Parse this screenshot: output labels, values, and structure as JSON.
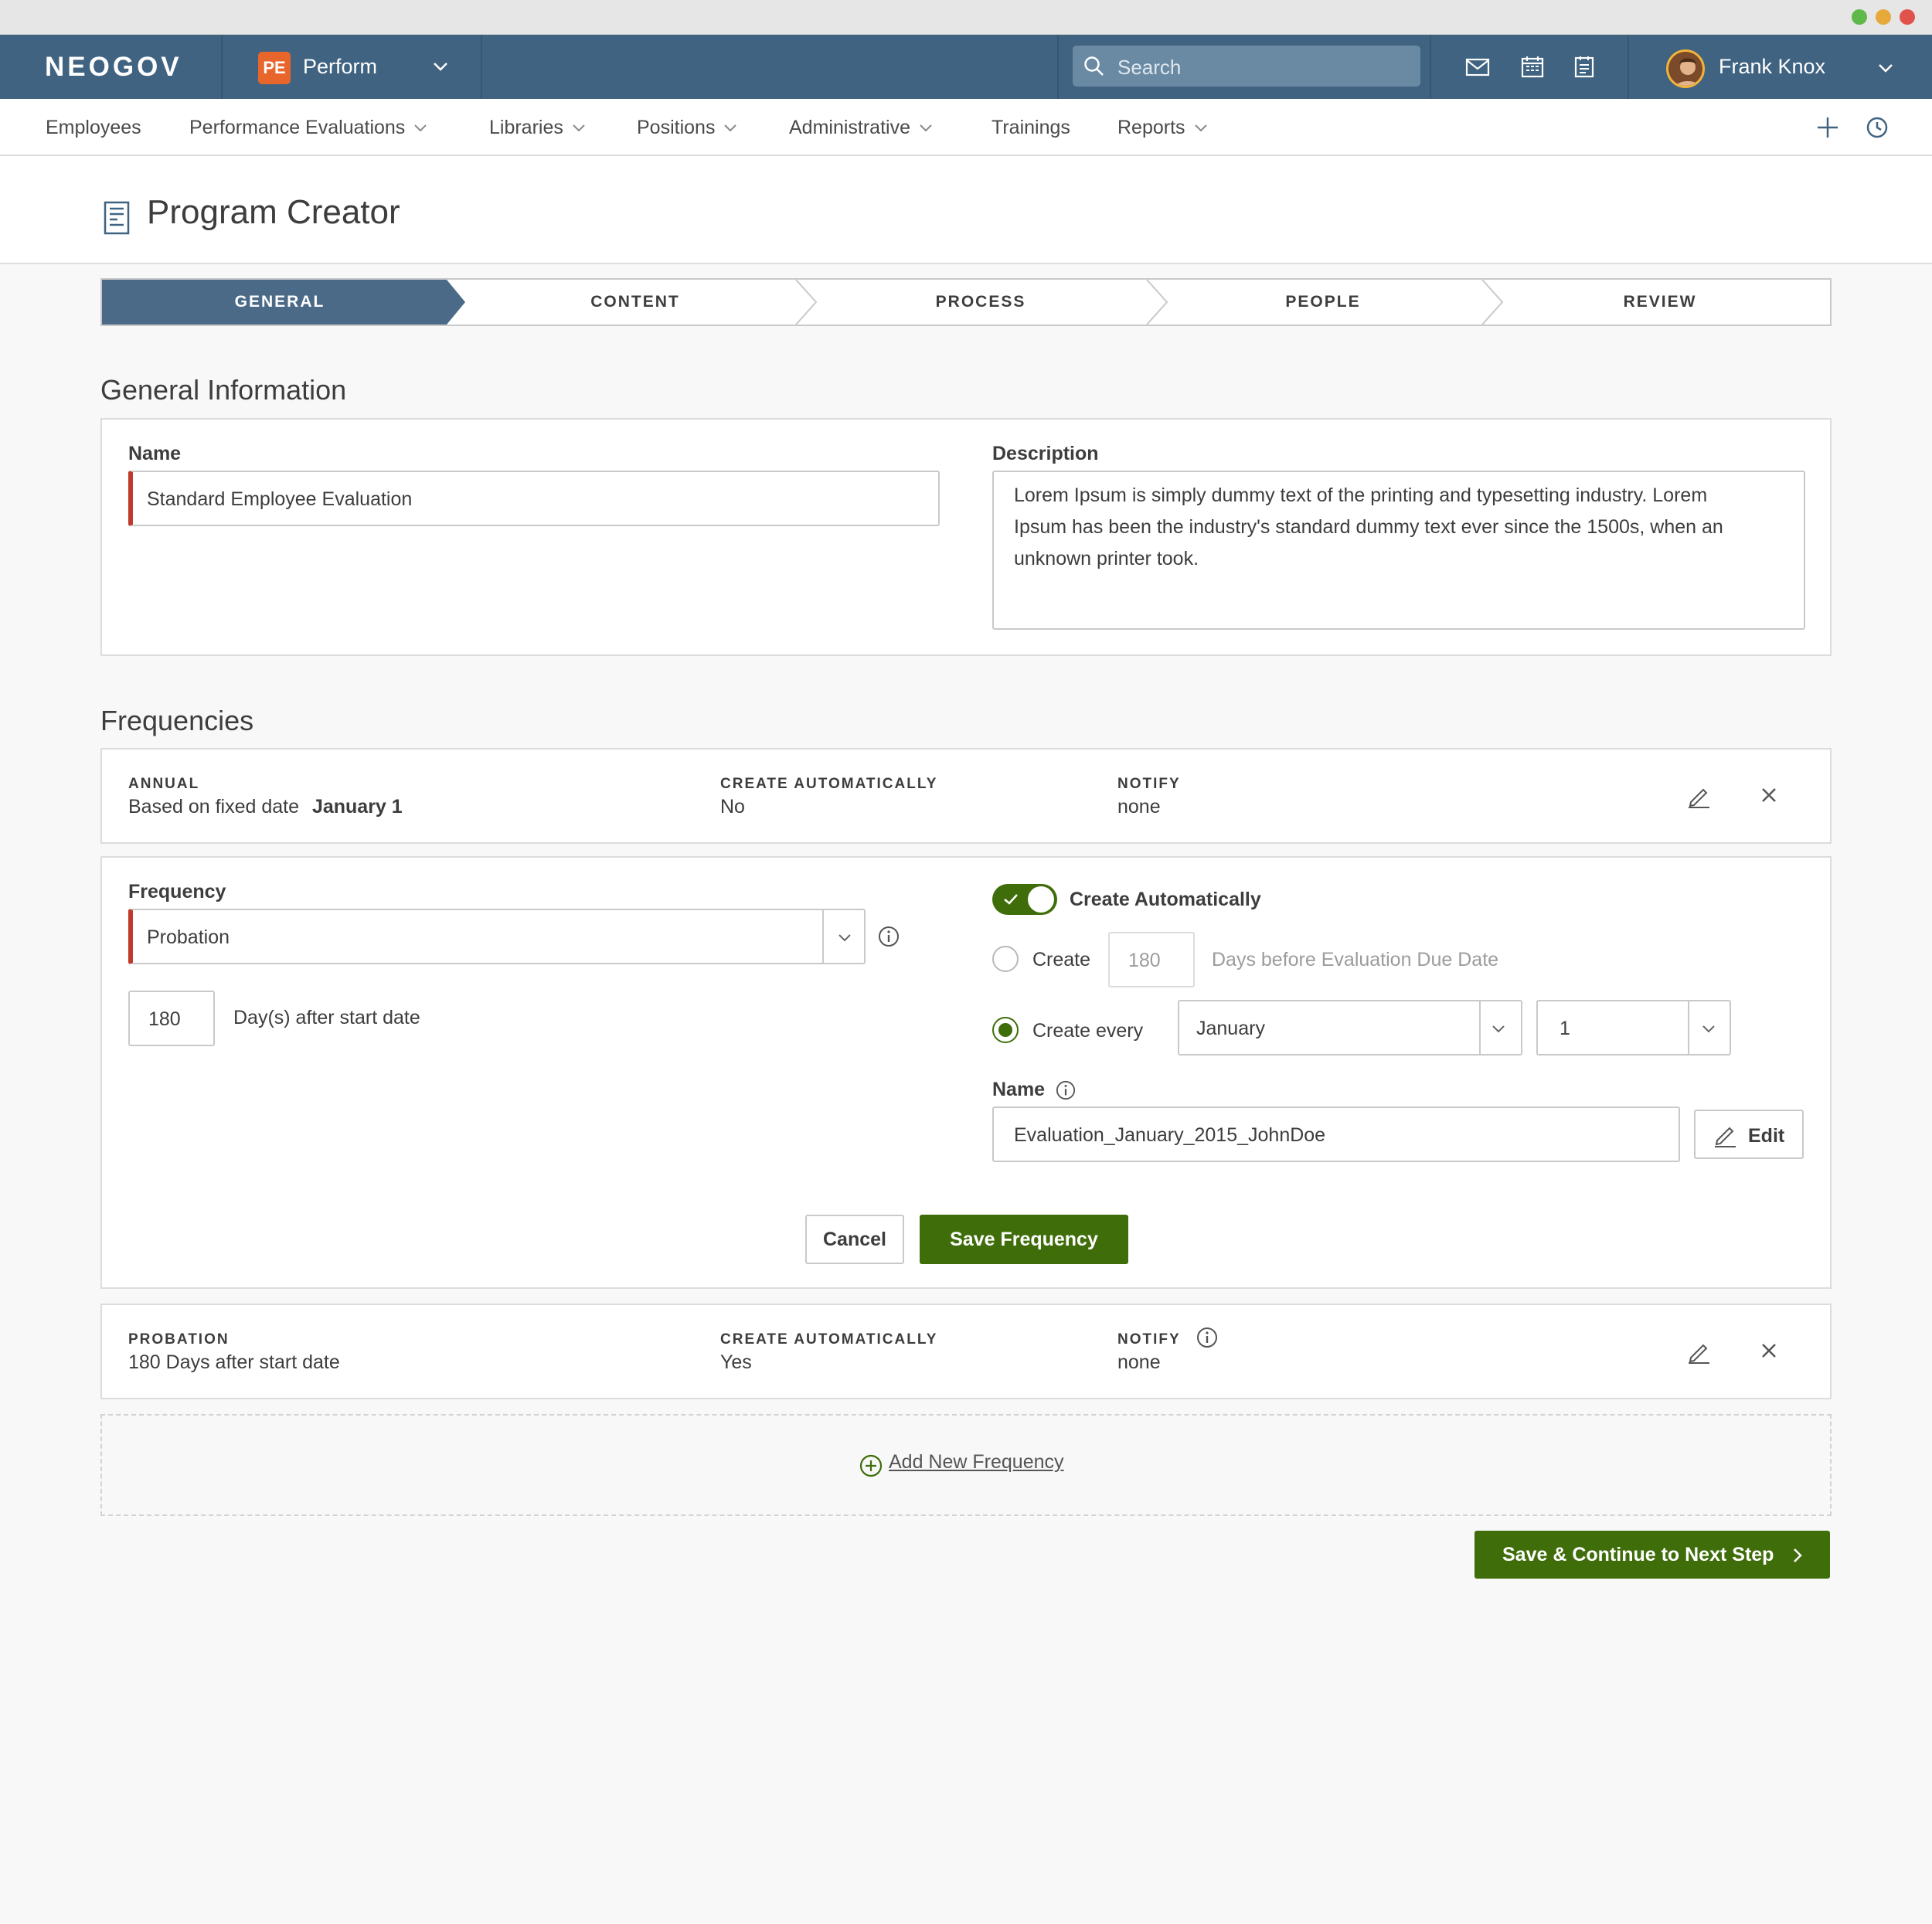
{
  "colors": {
    "header_bg": "#3f6381",
    "accent_green": "#3f6d0a",
    "required_red": "#c0392b",
    "app_badge": "#e8662c"
  },
  "header": {
    "logo": "NEOGOV",
    "app_badge": "PE",
    "app_name": "Perform",
    "search_placeholder": "Search",
    "user_name": "Frank Knox"
  },
  "nav": {
    "items": [
      {
        "label": "Employees"
      },
      {
        "label": "Performance Evaluations"
      },
      {
        "label": "Libraries"
      },
      {
        "label": "Positions"
      },
      {
        "label": "Administrative"
      },
      {
        "label": "Trainings"
      },
      {
        "label": "Reports"
      }
    ]
  },
  "page": {
    "title": "Program Creator"
  },
  "steps": [
    {
      "label": "GENERAL",
      "active": true
    },
    {
      "label": "CONTENT",
      "active": false
    },
    {
      "label": "PROCESS",
      "active": false
    },
    {
      "label": "PEOPLE",
      "active": false
    },
    {
      "label": "REVIEW",
      "active": false
    }
  ],
  "general": {
    "heading": "General Information",
    "name_label": "Name",
    "name_value": "Standard Employee Evaluation",
    "description_label": "Description",
    "description_line1": "Lorem Ipsum is simply dummy text of the printing and typesetting industry. Lorem",
    "description_line2": "Ipsum has been the industry's standard dummy text ever since the 1500s, when an",
    "description_line3": "unknown printer took."
  },
  "frequencies": {
    "heading": "Frequencies",
    "annual": {
      "type_label": "ANNUAL",
      "detail_prefix": "Based on fixed date",
      "detail_date": "January 1",
      "create_auto_label": "CREATE AUTOMATICALLY",
      "create_auto_value": "No",
      "notify_label": "NOTIFY",
      "notify_value": "none"
    },
    "editor": {
      "frequency_label": "Frequency",
      "frequency_value": "Probation",
      "days_value": "180",
      "days_suffix": "Day(s) after start date",
      "toggle_label": "Create Automatically",
      "toggle_on": true,
      "create_label": "Create",
      "create_days_value": "180",
      "create_days_suffix": "Days before Evaluation Due Date",
      "create_every_label": "Create every",
      "month_value": "January",
      "day_value": "1",
      "name_label": "Name",
      "name_value": "Evaluation_January_2015_JohnDoe",
      "edit_label": "Edit",
      "cancel_label": "Cancel",
      "save_label": "Save Frequency"
    },
    "probation": {
      "type_label": "PROBATION",
      "detail": "180 Days after start date",
      "create_auto_label": "CREATE AUTOMATICALLY",
      "create_auto_value": "Yes",
      "notify_label": "NOTIFY",
      "notify_value": "none"
    },
    "add_label": "Add New Frequency"
  },
  "footer": {
    "continue_label": "Save & Continue to Next Step"
  }
}
